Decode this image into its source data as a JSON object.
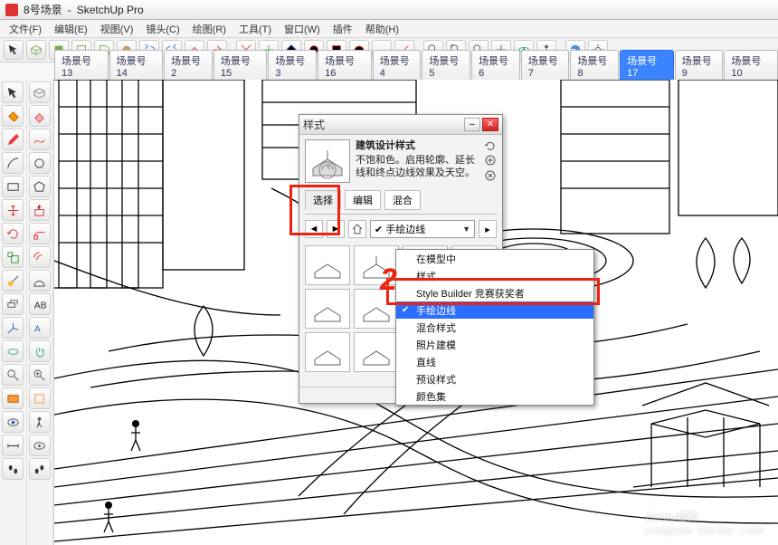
{
  "titlebar": {
    "doc": "8号场景",
    "app": "SketchUp Pro"
  },
  "menus": [
    "文件(F)",
    "编辑(E)",
    "视图(V)",
    "镜头(C)",
    "绘图(R)",
    "工具(T)",
    "窗口(W)",
    "插件",
    "帮助(H)"
  ],
  "scene_tabs": [
    "场景号13",
    "场景号14",
    "场景号2",
    "场景号15",
    "场景号3",
    "场景号16",
    "场景号4",
    "场景号5",
    "场景号6",
    "场景号7",
    "场景号8",
    "场景号17",
    "场景号9",
    "场景号10"
  ],
  "scene_active_index": 11,
  "styles_dialog": {
    "title": "样式",
    "style_name": "建筑设计样式",
    "description": "不饱和色。启用轮廓、延长线和终点边线效果及天空。",
    "tabs": [
      "选择",
      "编辑",
      "混合"
    ],
    "active_tab_index": 0,
    "combo_selected": "手绘边线"
  },
  "dropdown": {
    "items": [
      "在模型中",
      "样式",
      "Style Builder 竞赛获奖者",
      "手绘边线",
      "混合样式",
      "照片建模",
      "直线",
      "预设样式",
      "颜色集"
    ],
    "checked_index": 3,
    "selected_index": 3
  },
  "annotation_label": "2",
  "watermark": {
    "brand": "Baidu经验",
    "url": "jingyan.baidu.com"
  }
}
